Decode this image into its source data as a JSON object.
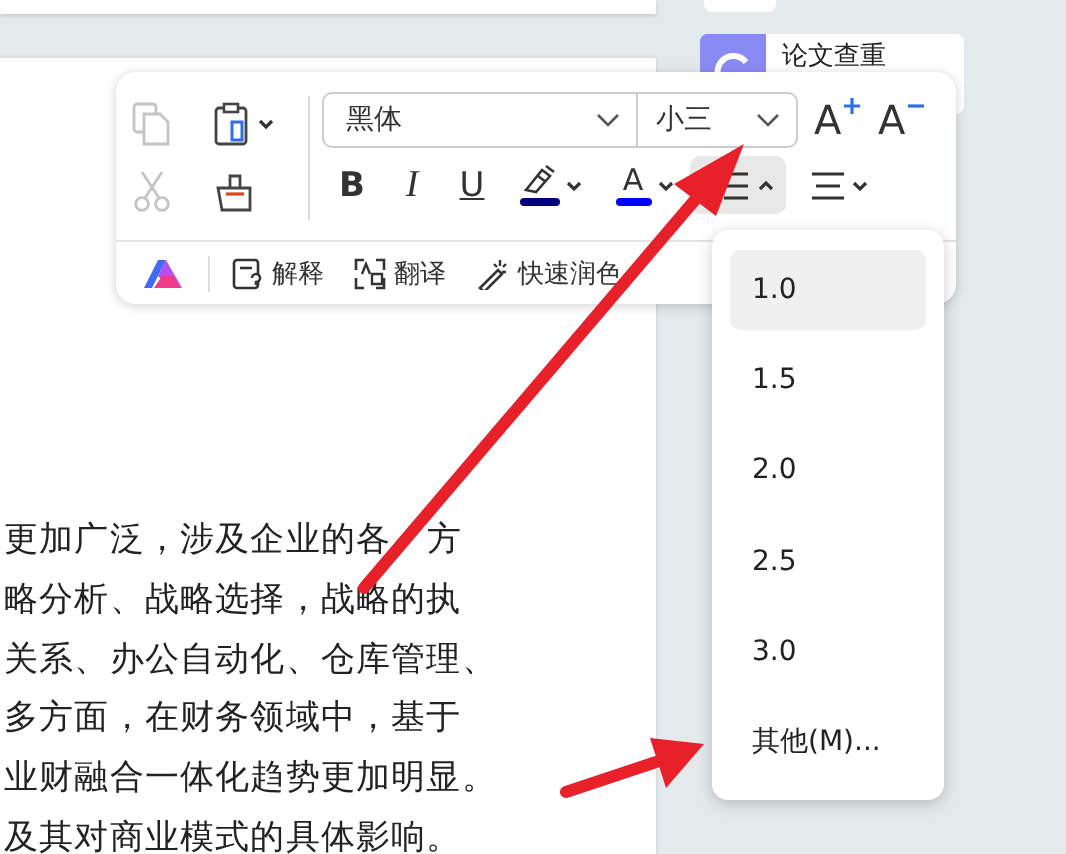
{
  "side_card": {
    "title": "论文查重"
  },
  "document": {
    "lines": [
      [
        "更加广泛，涉及企业的各",
        "方"
      ],
      [
        "略分析、战略选择，战略的执"
      ],
      [
        "关系、办公自动化、仓库管理、"
      ],
      [
        "多方面，在财务领域中，基于"
      ],
      [
        "业财融合一体化趋势更加明显。"
      ],
      [
        "及其对商业模式的具体影响。"
      ]
    ]
  },
  "toolbar": {
    "clipboard": [
      {
        "kind": "copy",
        "disabled": true
      },
      {
        "kind": "paste",
        "disabled": false
      },
      {
        "kind": "cut",
        "disabled": true
      },
      {
        "kind": "painter",
        "disabled": false
      }
    ],
    "font": "黑体",
    "size": "小三",
    "grow_label": "A",
    "shrink_label": "A",
    "format": [
      {
        "kind": "bold",
        "label": "B"
      },
      {
        "kind": "italic",
        "label": "I"
      },
      {
        "kind": "underline",
        "label": "U"
      }
    ],
    "highlight": {
      "color": "#000080"
    },
    "font_color": {
      "label": "A",
      "color": "#0000ff"
    },
    "line_spacing": {
      "selected": true,
      "expanded": true
    },
    "ai_actions": [
      {
        "kind": "explain",
        "label": "解释"
      },
      {
        "kind": "translate",
        "label": "翻译"
      },
      {
        "kind": "polish",
        "label": "快速润色"
      }
    ]
  },
  "spacing_menu": {
    "options": [
      {
        "label": "1.0",
        "selected": true
      },
      {
        "label": "1.5",
        "selected": false
      },
      {
        "label": "2.0",
        "selected": false
      },
      {
        "label": "2.5",
        "selected": false
      },
      {
        "label": "3.0",
        "selected": false
      },
      {
        "label": "其他(M)...",
        "selected": false
      }
    ]
  }
}
